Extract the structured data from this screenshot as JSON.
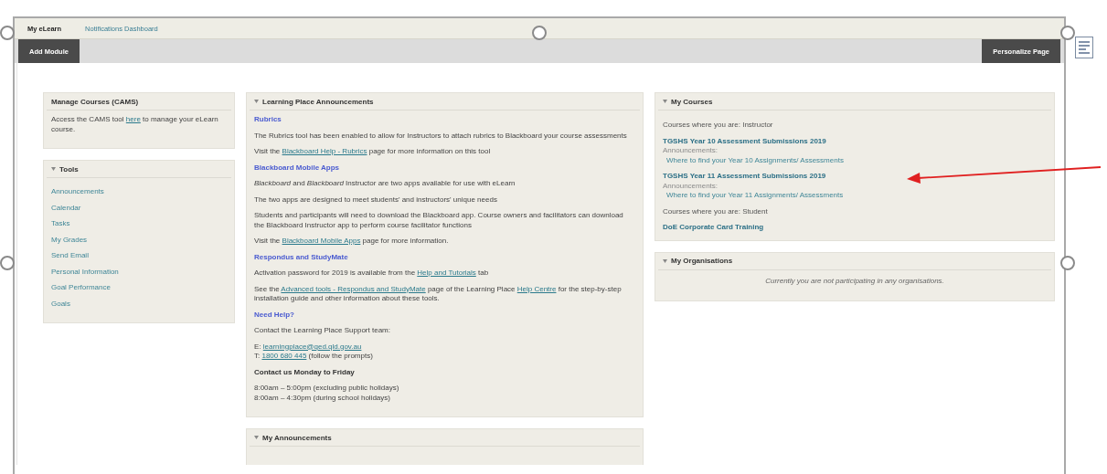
{
  "tabs": [
    {
      "label": "My eLearn",
      "selected": true
    },
    {
      "label": "Notifications Dashboard",
      "selected": false
    }
  ],
  "toolbar": {
    "left_button": "Add Module",
    "right_button": "Personalize Page"
  },
  "columns": [
    [
      {
        "title": "Manage Courses (CAMS)",
        "collapsible": false,
        "kind": "blocks",
        "blocks": [
          {
            "kind": "paragraph",
            "parts": [
              {
                "kind": "text",
                "text": "Access the CAMS tool "
              },
              {
                "kind": "link",
                "text": "here"
              },
              {
                "kind": "text",
                "text": " to manage your eLearn course."
              }
            ]
          }
        ]
      },
      {
        "title": "Tools",
        "collapsible": true,
        "kind": "links",
        "links": [
          "Announcements",
          "Calendar",
          "Tasks",
          "My Grades",
          "Send Email",
          "Personal Information",
          "Goal Performance",
          "Goals"
        ]
      }
    ],
    [
      {
        "title": "Learning Place Announcements",
        "collapsible": true,
        "kind": "blocks",
        "blocks": [
          {
            "kind": "heading",
            "parts": [
              {
                "kind": "text",
                "text": "Rubrics"
              }
            ]
          },
          {
            "kind": "paragraph",
            "parts": [
              {
                "kind": "text",
                "text": "The Rubrics tool has been enabled to allow for Instructors to attach rubrics to Blackboard your course assessments"
              }
            ]
          },
          {
            "kind": "paragraph",
            "parts": [
              {
                "kind": "text",
                "text": "Visit the "
              },
              {
                "kind": "link",
                "text": "Blackboard Help - Rubrics"
              },
              {
                "kind": "text",
                "text": " page for more information on this tool"
              }
            ]
          },
          {
            "kind": "heading",
            "parts": [
              {
                "kind": "text",
                "text": "Blackboard Mobile Apps"
              }
            ]
          },
          {
            "kind": "paragraph",
            "parts": [
              {
                "kind": "text",
                "text": "*Blackboard* and *Blackboard* Instructor are two apps available for use with eLearn"
              }
            ]
          },
          {
            "kind": "paragraph",
            "parts": [
              {
                "kind": "text",
                "text": "The two apps are designed to meet students' and instructors' unique needs"
              }
            ]
          },
          {
            "kind": "paragraph",
            "parts": [
              {
                "kind": "text",
                "text": "Students and participants will need to download the Blackboard app. Course owners and facilitators can download the Blackboard Instructor app to perform course facilitator functions"
              }
            ]
          },
          {
            "kind": "paragraph",
            "parts": [
              {
                "kind": "text",
                "text": "Visit the "
              },
              {
                "kind": "link",
                "text": "Blackboard Mobile Apps"
              },
              {
                "kind": "text",
                "text": " page for more information."
              }
            ]
          },
          {
            "kind": "heading",
            "parts": [
              {
                "kind": "text",
                "text": "Respondus and StudyMate"
              }
            ]
          },
          {
            "kind": "paragraph",
            "parts": [
              {
                "kind": "text",
                "text": "Activation password for 2019 is available from the "
              },
              {
                "kind": "link",
                "text": "Help and Tutorials"
              },
              {
                "kind": "text",
                "text": " tab"
              }
            ]
          },
          {
            "kind": "paragraph",
            "parts": [
              {
                "kind": "text",
                "text": "See the "
              },
              {
                "kind": "link",
                "text": "Advanced tools - Respondus and StudyMate"
              },
              {
                "kind": "text",
                "text": " page of the Learning Place "
              },
              {
                "kind": "link",
                "text": "Help Centre"
              },
              {
                "kind": "text",
                "text": " for the step-by-step installation guide and other information about these tools."
              }
            ]
          },
          {
            "kind": "heading",
            "parts": [
              {
                "kind": "text",
                "text": "Need Help?"
              }
            ]
          },
          {
            "kind": "paragraph",
            "parts": [
              {
                "kind": "text",
                "text": "Contact the Learning Place Support team:"
              }
            ]
          },
          {
            "kind": "line",
            "parts": [
              {
                "kind": "text",
                "text": "E: "
              },
              {
                "kind": "link",
                "text": "learningplace@qed.qld.gov.au"
              }
            ]
          },
          {
            "kind": "paragraph",
            "parts": [
              {
                "kind": "text",
                "text": "T: "
              },
              {
                "kind": "link",
                "text": "1800 680 445"
              },
              {
                "kind": "text",
                "text": " (follow the prompts)"
              }
            ]
          },
          {
            "kind": "strong",
            "parts": [
              {
                "kind": "text",
                "text": "Contact us Monday to Friday"
              }
            ]
          },
          {
            "kind": "line",
            "parts": [
              {
                "kind": "text",
                "text": "8:00am – 5:00pm (excluding public holidays)"
              }
            ]
          },
          {
            "kind": "paragraph",
            "parts": [
              {
                "kind": "text",
                "text": "8:00am – 4:30pm (during school holidays)"
              }
            ]
          }
        ]
      },
      {
        "title": "My Announcements",
        "collapsible": true,
        "kind": "cut"
      }
    ],
    [
      {
        "title": "My Courses",
        "collapsible": true,
        "kind": "courses",
        "items": [
          {
            "kind": "label",
            "text": "Courses where you are: Instructor"
          },
          {
            "kind": "course",
            "text": "TGSHS Year 10 Assessment Submissions 2019"
          },
          {
            "kind": "sublabel",
            "text": "Announcements:"
          },
          {
            "kind": "announcement",
            "text": "Where to find your Year 10 Assignments/ Assessments"
          },
          {
            "kind": "course",
            "text": "TGSHS Year 11 Assessment Submissions 2019"
          },
          {
            "kind": "sublabel",
            "text": "Announcements:"
          },
          {
            "kind": "announcement",
            "text": "Where to find your Year 11 Assignments/ Assessments"
          },
          {
            "kind": "label",
            "text": "Courses where you are: Student"
          },
          {
            "kind": "course",
            "text": "DoE Corporate Card Training"
          }
        ]
      },
      {
        "title": "My Organisations",
        "collapsible": true,
        "kind": "message",
        "message": "Currently you are not participating in any organisations."
      }
    ]
  ]
}
